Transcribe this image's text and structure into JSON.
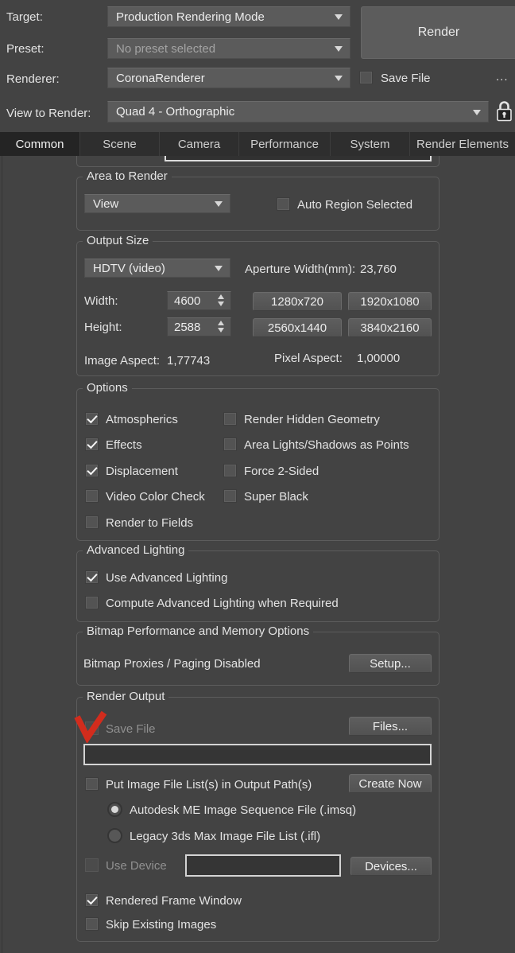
{
  "header": {
    "target_label": "Target:",
    "target_value": "Production Rendering Mode",
    "preset_label": "Preset:",
    "preset_value": "No preset selected",
    "renderer_label": "Renderer:",
    "renderer_value": "CoronaRenderer",
    "save_file_label": "Save File",
    "save_file_checked": false,
    "more_button": "...",
    "view_label": "View to Render:",
    "view_value": "Quad 4 - Orthographic",
    "render_button": "Render"
  },
  "tabs": {
    "items": [
      {
        "label": "Common",
        "active": true
      },
      {
        "label": "Scene",
        "active": false
      },
      {
        "label": "Camera",
        "active": false
      },
      {
        "label": "Performance",
        "active": false
      },
      {
        "label": "System",
        "active": false
      },
      {
        "label": "Render Elements",
        "active": false
      }
    ]
  },
  "sections": {
    "area": {
      "title": "Area to Render",
      "view_value": "View",
      "auto_region_label": "Auto Region Selected",
      "auto_region_checked": false
    },
    "output": {
      "title": "Output Size",
      "preset_value": "HDTV (video)",
      "aperture_label": "Aperture Width(mm):",
      "aperture_value": "23,760",
      "width_label": "Width:",
      "width_value": "4600",
      "height_label": "Height:",
      "height_value": "2588",
      "buttons": [
        "1280x720",
        "1920x1080",
        "2560x1440",
        "3840x2160"
      ],
      "image_aspect_label": "Image Aspect:",
      "image_aspect_value": "1,77743",
      "pixel_aspect_label": "Pixel Aspect:",
      "pixel_aspect_value": "1,00000"
    },
    "options": {
      "title": "Options",
      "left": [
        {
          "label": "Atmospherics",
          "checked": true
        },
        {
          "label": "Effects",
          "checked": true
        },
        {
          "label": "Displacement",
          "checked": true
        },
        {
          "label": "Video Color Check",
          "checked": false
        },
        {
          "label": "Render to Fields",
          "checked": false
        }
      ],
      "right": [
        {
          "label": "Render Hidden Geometry",
          "checked": false
        },
        {
          "label": "Area Lights/Shadows as Points",
          "checked": false
        },
        {
          "label": "Force 2-Sided",
          "checked": false
        },
        {
          "label": "Super Black",
          "checked": false
        }
      ]
    },
    "advanced": {
      "title": "Advanced Lighting",
      "items": [
        {
          "label": "Use Advanced Lighting",
          "checked": true
        },
        {
          "label": "Compute Advanced Lighting when Required",
          "checked": false
        }
      ]
    },
    "bitmap": {
      "title": "Bitmap Performance and Memory Options",
      "status_text": "Bitmap Proxies / Paging Disabled",
      "setup_button": "Setup..."
    },
    "render_output": {
      "title": "Render Output",
      "save_file_label": "Save File",
      "save_file_checked": false,
      "save_file_disabled": true,
      "files_button": "Files...",
      "path_value": "",
      "put_image_label": "Put Image File List(s) in Output Path(s)",
      "put_image_checked": false,
      "create_now_button": "Create Now",
      "radio_imsq": "Autodesk ME Image Sequence File (.imsq)",
      "radio_imsq_selected": true,
      "radio_ifl": "Legacy 3ds Max Image File List (.ifl)",
      "radio_ifl_selected": false,
      "use_device_label": "Use Device",
      "use_device_checked": false,
      "device_value": "",
      "devices_button": "Devices...",
      "rendered_frame_label": "Rendered Frame Window",
      "rendered_frame_checked": true,
      "skip_existing_label": "Skip Existing Images",
      "skip_existing_checked": false
    }
  },
  "colors": {
    "annotation_red": "#d22c1d",
    "panel_bg": "#434343",
    "tabbar_bg": "#2e2e2e"
  }
}
